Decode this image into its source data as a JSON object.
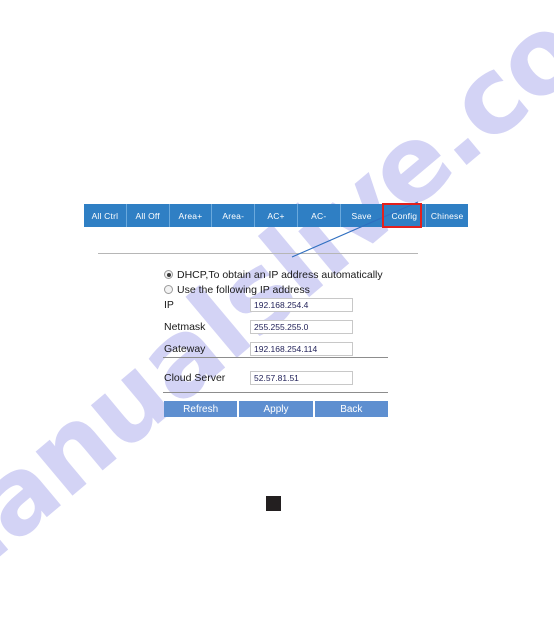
{
  "watermark": {
    "text": "manualslive.com"
  },
  "toolbar": {
    "buttons": [
      {
        "label": "All Ctrl",
        "name": "toolbar-all-ctrl"
      },
      {
        "label": "All Off",
        "name": "toolbar-all-off"
      },
      {
        "label": "Area+",
        "name": "toolbar-area-plus"
      },
      {
        "label": "Area-",
        "name": "toolbar-area-minus"
      },
      {
        "label": "AC+",
        "name": "toolbar-ac-plus"
      },
      {
        "label": "AC-",
        "name": "toolbar-ac-minus"
      },
      {
        "label": "Save",
        "name": "toolbar-save"
      },
      {
        "label": "Config",
        "name": "toolbar-config"
      },
      {
        "label": "Chinese",
        "name": "toolbar-chinese"
      }
    ],
    "highlight_color": "#e3201c",
    "background_color": "#2f7fc4",
    "highlighted_button": "Config"
  },
  "annotation": {
    "line_color": "#2f6fc0"
  },
  "ip_mode": {
    "options": [
      {
        "label": "DHCP,To obtain an IP address automatically",
        "selected": true
      },
      {
        "label": "Use the following IP address",
        "selected": false
      }
    ]
  },
  "network_form": {
    "fields": [
      {
        "label": "IP",
        "value": "192.168.254.4"
      },
      {
        "label": "Netmask",
        "value": "255.255.255.0"
      },
      {
        "label": "Gateway",
        "value": "192.168.254.114"
      }
    ]
  },
  "cloud": {
    "label": "Cloud Server",
    "value": "52.57.81.51"
  },
  "actions": {
    "buttons": [
      {
        "label": "Refresh",
        "name": "refresh-button"
      },
      {
        "label": "Apply",
        "name": "apply-button"
      },
      {
        "label": "Back",
        "name": "back-button"
      }
    ],
    "background_color": "#5e8fd0"
  }
}
